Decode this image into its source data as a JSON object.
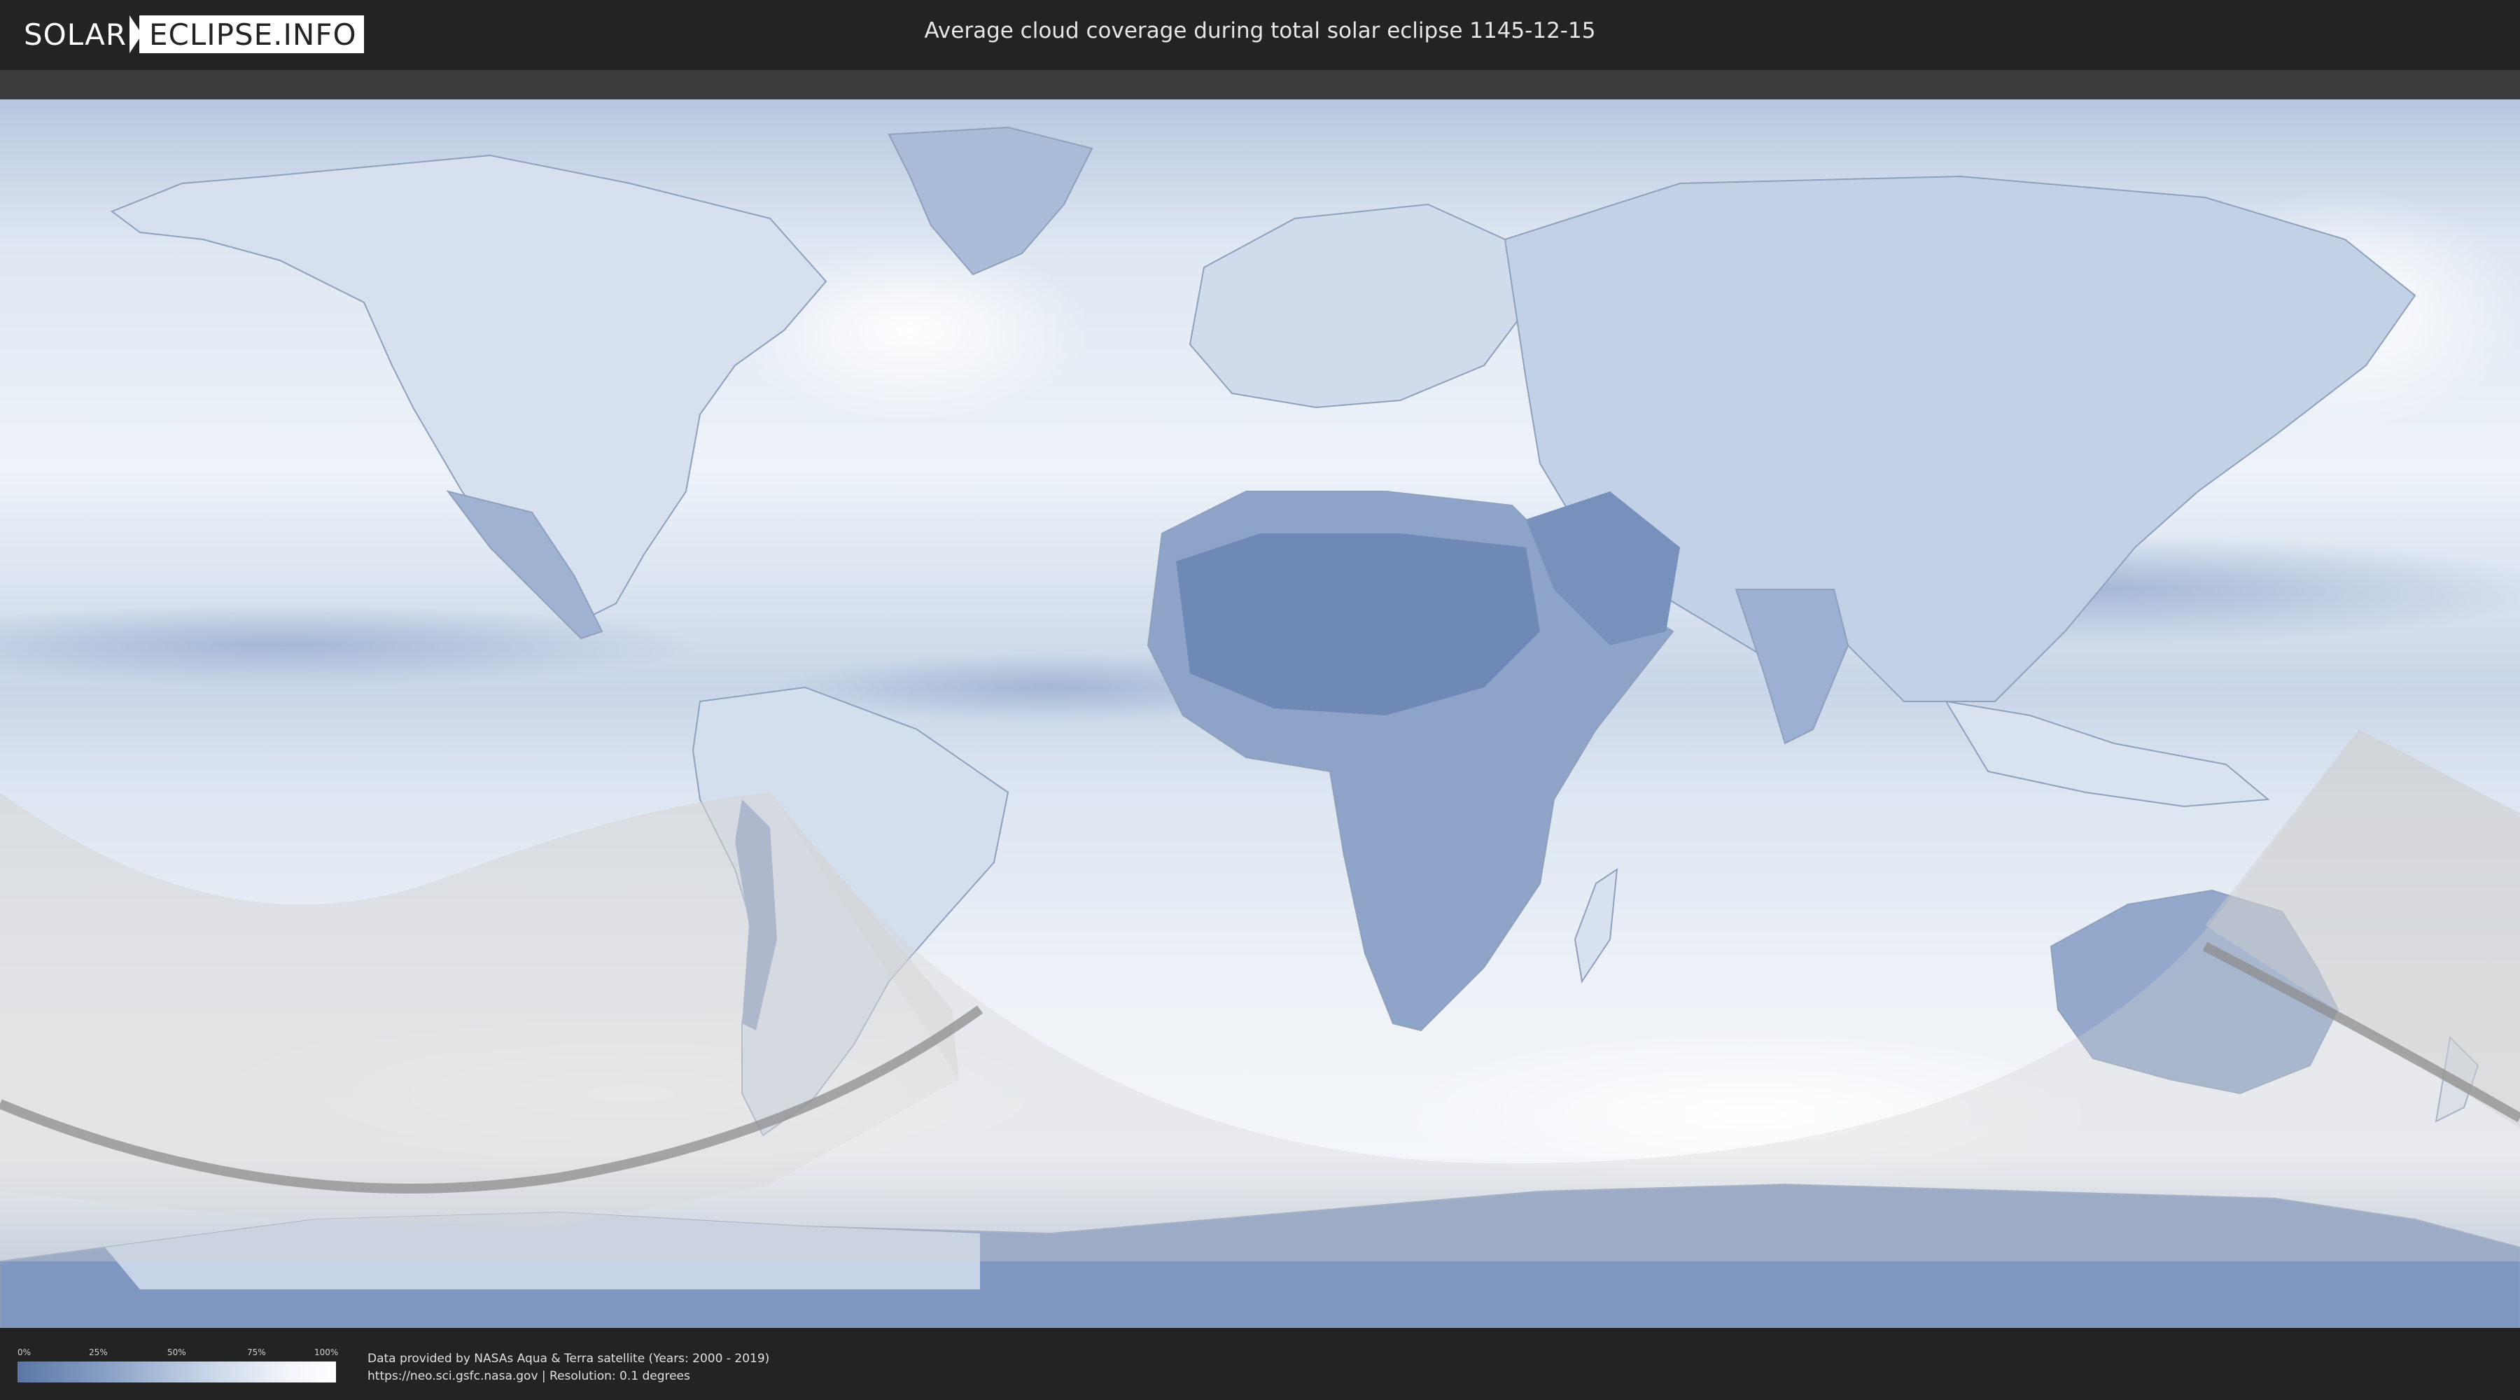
{
  "header": {
    "logo_left": "SOLAR",
    "logo_right": "ECLIPSE.INFO",
    "title": "Average cloud coverage during total solar eclipse 1145-12-15"
  },
  "legend": {
    "ticks": [
      "0%",
      "25%",
      "50%",
      "75%",
      "100%"
    ],
    "colors": {
      "low": "#5b76a6",
      "high": "#ffffff"
    }
  },
  "credits": {
    "line1": "Data provided by NASAs Aqua & Terra satellite (Years: 2000 - 2019)",
    "line2": "https://neo.sci.gsfc.nasa.gov | Resolution: 0.1 degrees"
  },
  "map": {
    "colors": {
      "ocean_cloud": "#dfe8f3",
      "clear_land": "#6f89b7",
      "eclipse_shade": "#cfcfcf",
      "path_line": "#8e8e8e"
    }
  }
}
